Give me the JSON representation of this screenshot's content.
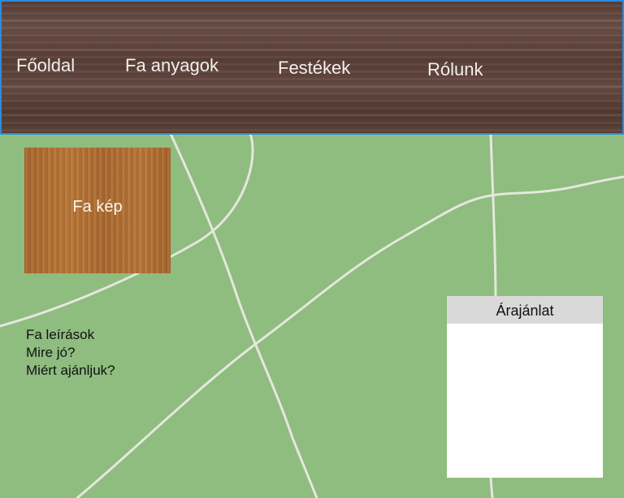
{
  "nav": {
    "items": [
      {
        "label": "Főoldal"
      },
      {
        "label": "Fa anyagok"
      },
      {
        "label": "Festékek"
      },
      {
        "label": "Rólunk"
      }
    ]
  },
  "main": {
    "wood_image": {
      "label": "Fa kép"
    },
    "description": {
      "lines": [
        "Fa leírások",
        "Mire jó?",
        "Miért ajánljuk?"
      ]
    },
    "offer": {
      "title": "Árajánlat"
    }
  },
  "colors": {
    "background": "#8fbc7f",
    "header_wood": "#5e443b",
    "header_border": "#2a8ce0",
    "wood_image": "#b0713a",
    "panel": "#ffffff",
    "panel_header": "#d9d9d9"
  }
}
